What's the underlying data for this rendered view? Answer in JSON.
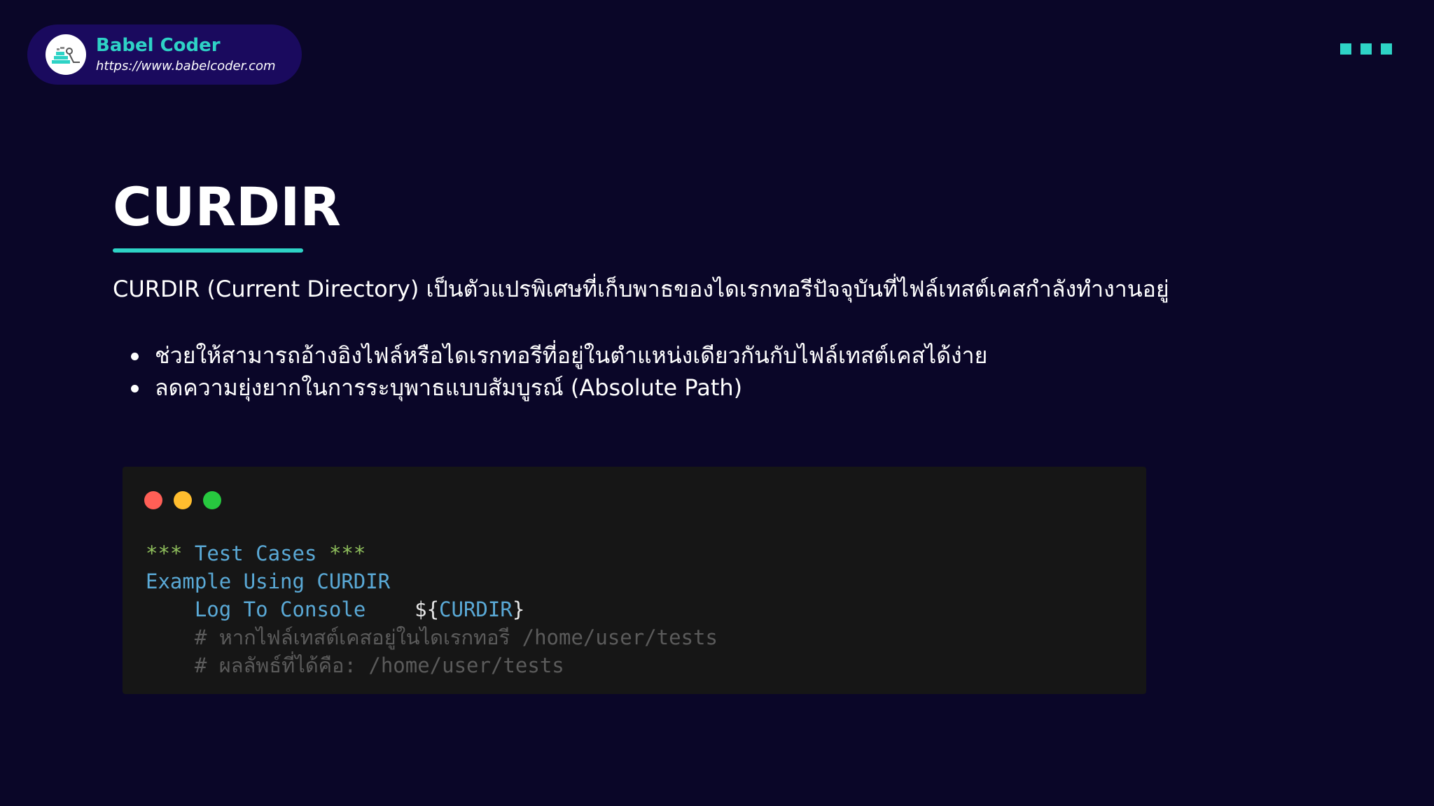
{
  "brand": {
    "name": "Babel Coder",
    "url": "https://www.babelcoder.com",
    "logo_icon": "babel-coder-logo-icon"
  },
  "slide": {
    "title": "CURDIR",
    "intro": "CURDIR (Current Directory) เป็นตัวแปรพิเศษที่เก็บพาธของไดเรกทอรีปัจจุบันที่ไฟล์เทสต์เคสกำลังทำงานอยู่",
    "bullets": [
      "ช่วยให้สามารถอ้างอิงไฟล์หรือไดเรกทอรีที่อยู่ในตำแหน่งเดียวกันกับไฟล์เทสต์เคสได้ง่าย",
      "ลดความยุ่งยากในการระบุพาธแบบสัมบูรณ์ (Absolute Path)"
    ]
  },
  "code": {
    "section_stars_open": "***",
    "section_name": "Test Cases",
    "section_stars_close": "***",
    "test_case_name": "Example Using CURDIR",
    "keyword": "Log To Console",
    "var_open": "${",
    "var_name": "CURDIR",
    "var_close": "}",
    "comment_1": "# หากไฟล์เทสต์เคสอยู่ในไดเรกทอรี /home/user/tests",
    "comment_2": "# ผลลัพธ์ที่ได้คือ: /home/user/tests"
  },
  "colors": {
    "background": "#0a0628",
    "accent": "#2ed3c6",
    "badge": "#1a0a5e",
    "code_bg": "#161616"
  }
}
